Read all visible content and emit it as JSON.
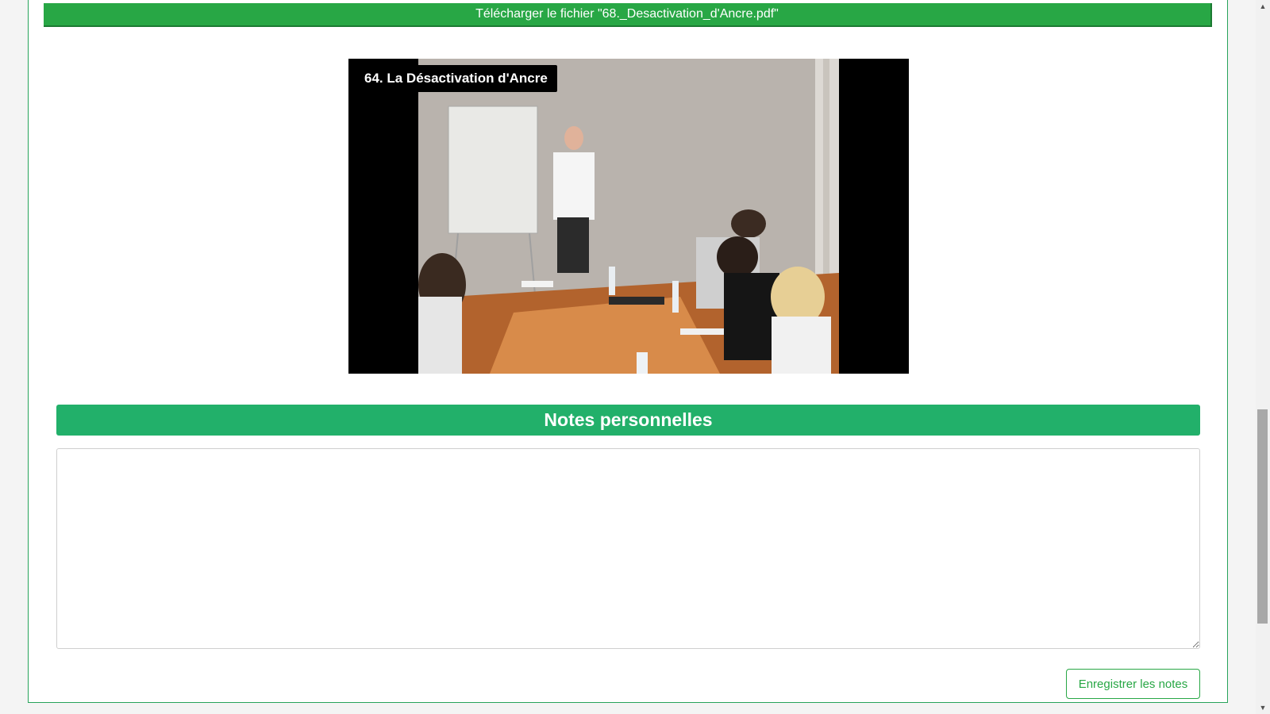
{
  "download": {
    "label": "Télécharger le fichier \"68._Desactivation_d'Ancre.pdf\""
  },
  "video": {
    "title": "64. La Désactivation d'Ancre"
  },
  "notes": {
    "header": "Notes personnelles",
    "value": "",
    "save_label": "Enregistrer les notes"
  },
  "colors": {
    "accent": "#22b06a",
    "button_green": "#28a745"
  },
  "icons": {
    "scroll_up": "triangle-up",
    "scroll_down": "triangle-down"
  }
}
